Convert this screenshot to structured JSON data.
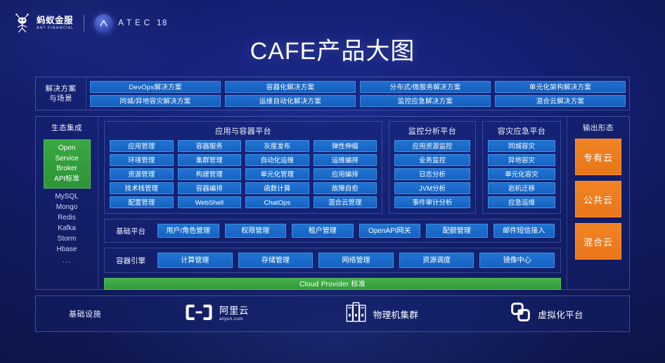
{
  "header": {
    "brand_cn": "蚂蚁金服",
    "brand_en": "ANT FINANCIAL",
    "event_letters": "ATEC",
    "event_year": "18",
    "title": "CAFE产品大图"
  },
  "solutions": {
    "label_line1": "解决方案",
    "label_line2": "与场景",
    "row1": [
      "DevOps解决方案",
      "容器化解决方案",
      "分布式/微服务解决方案",
      "单元化架构解决方案"
    ],
    "row2": [
      "同城/异地容灾解决方案",
      "运维自动化解决方案",
      "监控应急解决方案",
      "混合云解决方案"
    ]
  },
  "ecosystem": {
    "title": "生态集成",
    "standard_box": [
      "Open",
      "Service",
      "Broker",
      "API标准"
    ],
    "items": [
      "MySQL",
      "Mongo",
      "Redis",
      "Kafka",
      "Storm",
      "Hbase",
      "..."
    ]
  },
  "platforms": [
    {
      "title": "应用与容器平台",
      "columns": [
        [
          "应用管理",
          "环境管理",
          "资源管理",
          "技术栈管理",
          "配置管理"
        ],
        [
          "容器服务",
          "集群管理",
          "构建管理",
          "容器编排",
          "WebShell"
        ],
        [
          "灰度发布",
          "自动化运维",
          "单元化管理",
          "函数计算",
          "ChatOps"
        ],
        [
          "弹性伸缩",
          "运维编排",
          "应用编排",
          "故障自愈",
          "混合云管理"
        ]
      ]
    },
    {
      "title": "监控分析平台",
      "columns": [
        [
          "应用资源监控",
          "业务监控",
          "日志分析",
          "JVM分析",
          "事件审计分析"
        ]
      ]
    },
    {
      "title": "容灾应急平台",
      "columns": [
        [
          "同城容灾",
          "异地容灾",
          "单元化容灾",
          "岩机迁移",
          "应急运维"
        ]
      ]
    }
  ],
  "base_platform": {
    "label": "基础平台",
    "items": [
      "用户/角色管理",
      "权限管理",
      "租户管理",
      "OpenAPI网关",
      "配额管理",
      "邮件短信接入"
    ]
  },
  "container_engine": {
    "label": "容器引擎",
    "items": [
      "计算管理",
      "存储管理",
      "网络管理",
      "资源调度",
      "镜像中心"
    ],
    "provider_bar": "Cloud Provider 标准"
  },
  "output_forms": {
    "title": "输出形态",
    "items": [
      "专有云",
      "公共云",
      "混合云"
    ]
  },
  "infrastructure": {
    "label": "基础设施",
    "items": [
      {
        "icon": "aliyun-logo-icon",
        "name_cn": "阿里云",
        "name_en": "aliyun.com"
      },
      {
        "icon": "server-rack-icon",
        "name_cn": "物理机集群",
        "name_en": ""
      },
      {
        "icon": "virtualization-icon",
        "name_cn": "虚拟化平台",
        "name_en": ""
      }
    ]
  },
  "colors": {
    "background": "#141f72",
    "cell_blue": "#1a6cc8",
    "green": "#2f9a3a",
    "orange": "#ee7c1e",
    "text": "#ffffff"
  }
}
